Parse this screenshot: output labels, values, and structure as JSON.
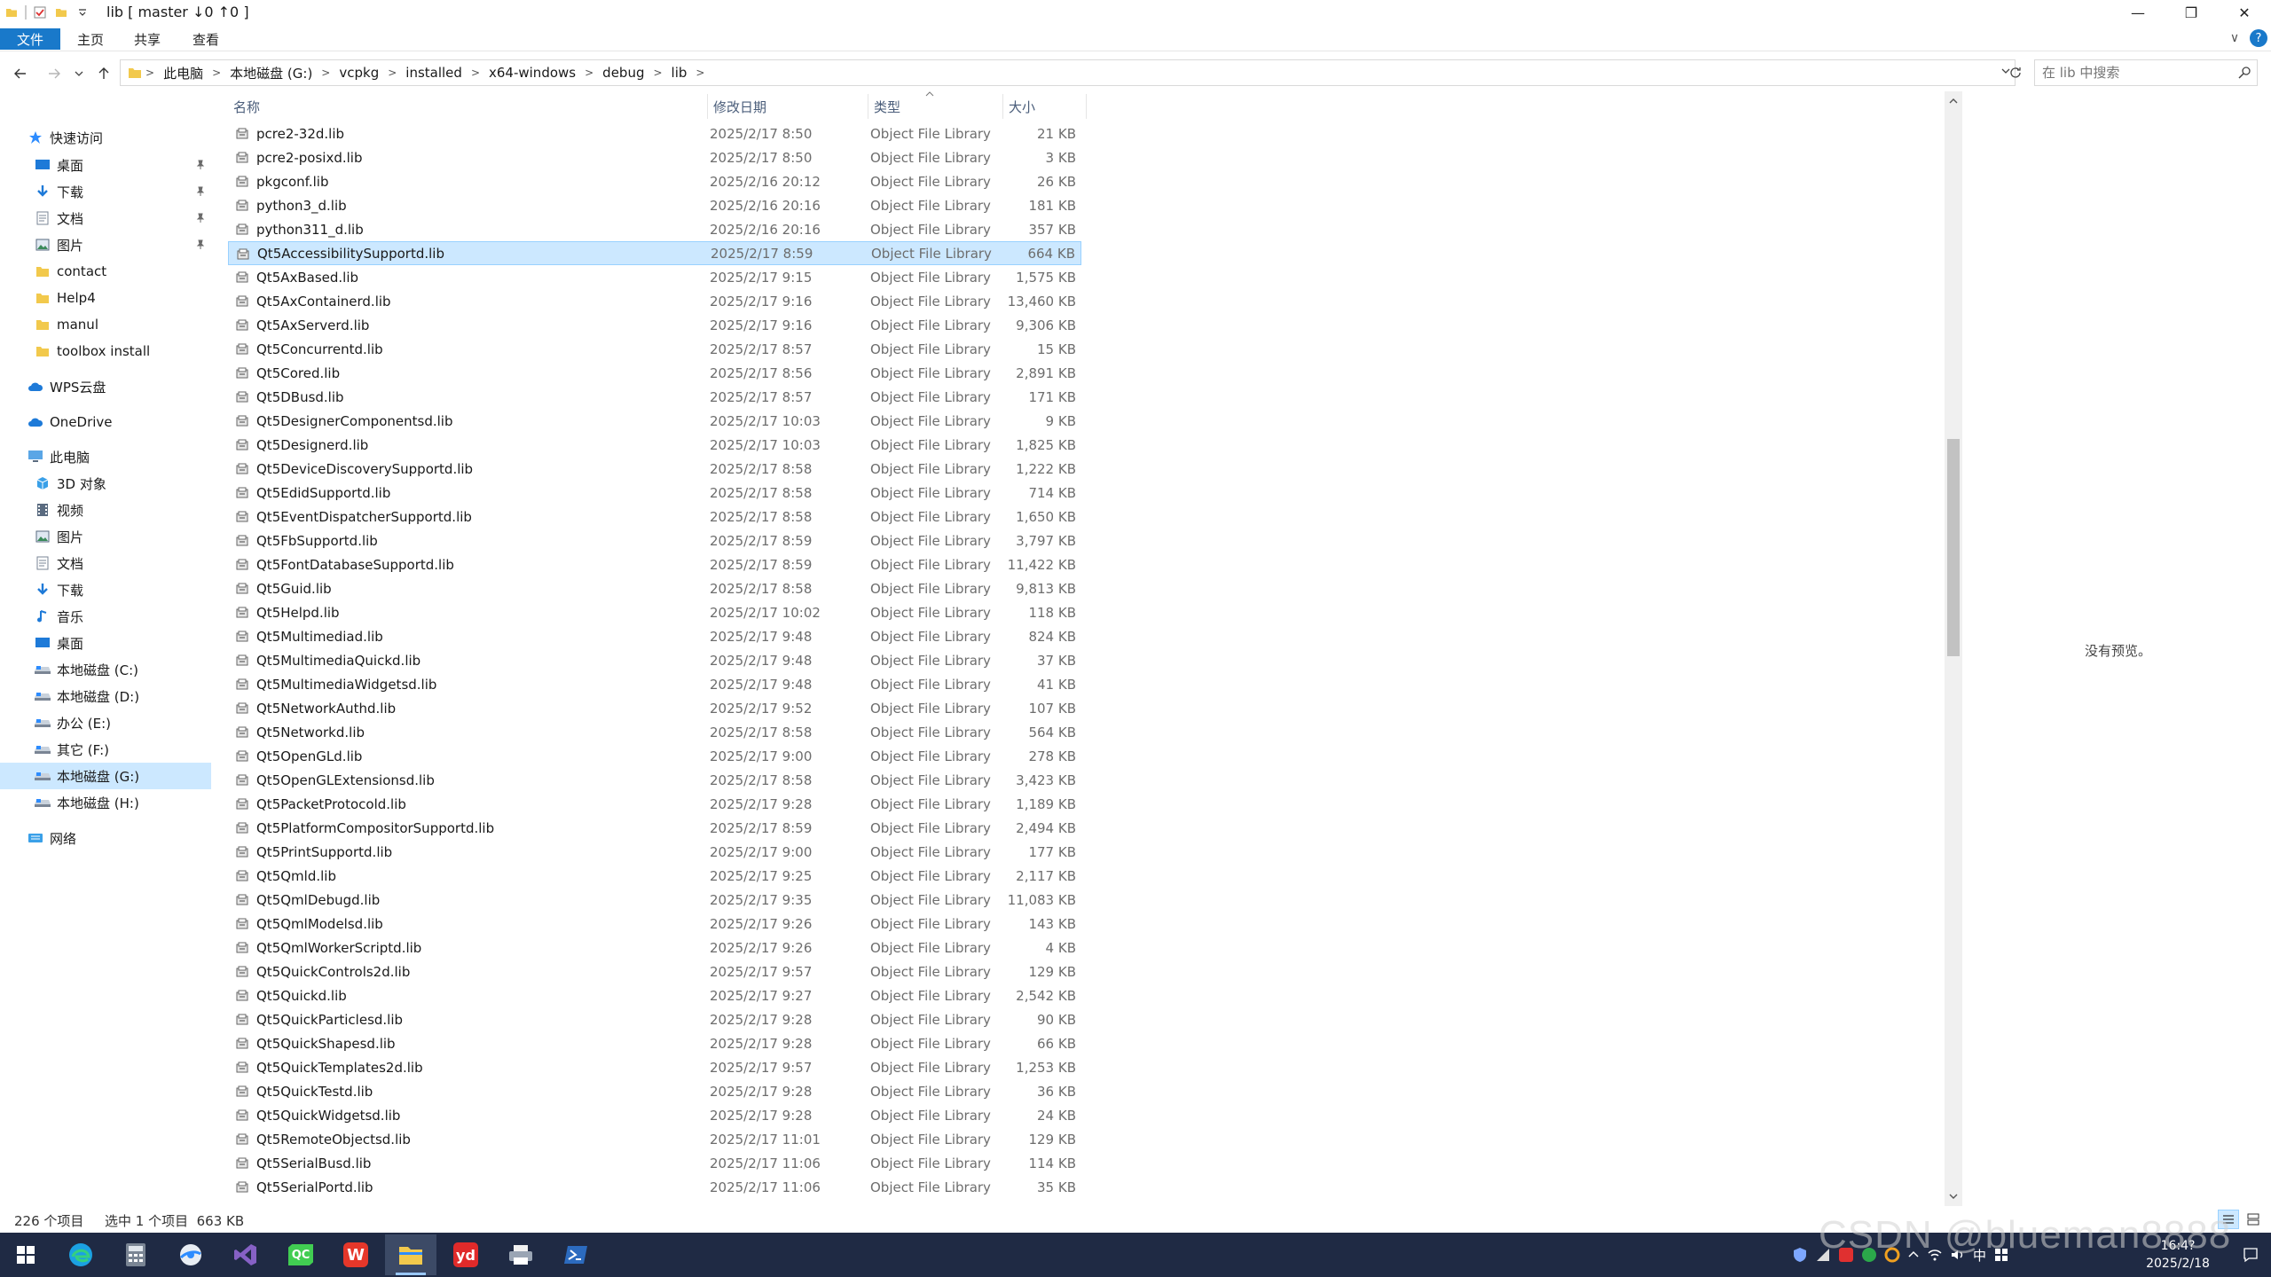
{
  "window": {
    "title": "lib [ master ↓0 ↑0 ]",
    "minimize_glyph": "—",
    "maximize_glyph": "❐",
    "close_glyph": "✕"
  },
  "ribbon": {
    "tabs": [
      "文件",
      "主页",
      "共享",
      "查看"
    ],
    "expand_glyph": "∨",
    "help_glyph": "?"
  },
  "address": {
    "crumbs": [
      "此电脑",
      "本地磁盘 (G:)",
      "vcpkg",
      "installed",
      "x64-windows",
      "debug",
      "lib"
    ],
    "separator": ">"
  },
  "search": {
    "placeholder": "在 lib 中搜索"
  },
  "nav_pane": {
    "items": [
      {
        "label": "快速访问",
        "icon": "star-icon",
        "pinned": false,
        "indent": 1
      },
      {
        "label": "桌面",
        "icon": "desktop-icon",
        "pinned": true,
        "indent": 2
      },
      {
        "label": "下载",
        "icon": "download-icon",
        "pinned": true,
        "indent": 2
      },
      {
        "label": "文档",
        "icon": "document-icon",
        "pinned": true,
        "indent": 2
      },
      {
        "label": "图片",
        "icon": "picture-icon",
        "pinned": true,
        "indent": 2
      },
      {
        "label": "contact",
        "icon": "folder-icon",
        "pinned": false,
        "indent": 2
      },
      {
        "label": "Help4",
        "icon": "folder-icon",
        "pinned": false,
        "indent": 2
      },
      {
        "label": "manul",
        "icon": "folder-icon",
        "pinned": false,
        "indent": 2
      },
      {
        "label": "toolbox install",
        "icon": "folder-icon",
        "pinned": false,
        "indent": 2
      },
      {
        "label": "WPS云盘",
        "icon": "cloud-icon",
        "pinned": false,
        "indent": 1
      },
      {
        "label": "OneDrive",
        "icon": "cloud-icon",
        "pinned": false,
        "indent": 1
      },
      {
        "label": "此电脑",
        "icon": "computer-icon",
        "pinned": false,
        "indent": 1
      },
      {
        "label": "3D 对象",
        "icon": "cube-icon",
        "pinned": false,
        "indent": 2
      },
      {
        "label": "视频",
        "icon": "video-icon",
        "pinned": false,
        "indent": 2
      },
      {
        "label": "图片",
        "icon": "picture-icon",
        "pinned": false,
        "indent": 2
      },
      {
        "label": "文档",
        "icon": "document-icon",
        "pinned": false,
        "indent": 2
      },
      {
        "label": "下载",
        "icon": "download-icon",
        "pinned": false,
        "indent": 2
      },
      {
        "label": "音乐",
        "icon": "music-icon",
        "pinned": false,
        "indent": 2
      },
      {
        "label": "桌面",
        "icon": "desktop-icon",
        "pinned": false,
        "indent": 2
      },
      {
        "label": "本地磁盘 (C:)",
        "icon": "drive-icon",
        "pinned": false,
        "indent": 2
      },
      {
        "label": "本地磁盘 (D:)",
        "icon": "drive-icon",
        "pinned": false,
        "indent": 2
      },
      {
        "label": "办公 (E:)",
        "icon": "drive-icon",
        "pinned": false,
        "indent": 2
      },
      {
        "label": "其它 (F:)",
        "icon": "drive-icon",
        "pinned": false,
        "indent": 2
      },
      {
        "label": "本地磁盘 (G:)",
        "icon": "drive-icon",
        "pinned": false,
        "indent": 2,
        "selected": true
      },
      {
        "label": "本地磁盘 (H:)",
        "icon": "drive-icon",
        "pinned": false,
        "indent": 2
      },
      {
        "label": "网络",
        "icon": "network-icon",
        "pinned": false,
        "indent": 1
      }
    ]
  },
  "columns": {
    "name": "名称",
    "date": "修改日期",
    "type": "类型",
    "size": "大小"
  },
  "files": [
    {
      "name": "pcre2-32d.lib",
      "date": "2025/2/17 8:50",
      "type": "Object File Library",
      "size": "21 KB"
    },
    {
      "name": "pcre2-posixd.lib",
      "date": "2025/2/17 8:50",
      "type": "Object File Library",
      "size": "3 KB"
    },
    {
      "name": "pkgconf.lib",
      "date": "2025/2/16 20:12",
      "type": "Object File Library",
      "size": "26 KB"
    },
    {
      "name": "python3_d.lib",
      "date": "2025/2/16 20:16",
      "type": "Object File Library",
      "size": "181 KB"
    },
    {
      "name": "python311_d.lib",
      "date": "2025/2/16 20:16",
      "type": "Object File Library",
      "size": "357 KB"
    },
    {
      "name": "Qt5AccessibilitySupportd.lib",
      "date": "2025/2/17 8:59",
      "type": "Object File Library",
      "size": "664 KB",
      "selected": true
    },
    {
      "name": "Qt5AxBased.lib",
      "date": "2025/2/17 9:15",
      "type": "Object File Library",
      "size": "1,575 KB"
    },
    {
      "name": "Qt5AxContainerd.lib",
      "date": "2025/2/17 9:16",
      "type": "Object File Library",
      "size": "13,460 KB"
    },
    {
      "name": "Qt5AxServerd.lib",
      "date": "2025/2/17 9:16",
      "type": "Object File Library",
      "size": "9,306 KB"
    },
    {
      "name": "Qt5Concurrentd.lib",
      "date": "2025/2/17 8:57",
      "type": "Object File Library",
      "size": "15 KB"
    },
    {
      "name": "Qt5Cored.lib",
      "date": "2025/2/17 8:56",
      "type": "Object File Library",
      "size": "2,891 KB"
    },
    {
      "name": "Qt5DBusd.lib",
      "date": "2025/2/17 8:57",
      "type": "Object File Library",
      "size": "171 KB"
    },
    {
      "name": "Qt5DesignerComponentsd.lib",
      "date": "2025/2/17 10:03",
      "type": "Object File Library",
      "size": "9 KB"
    },
    {
      "name": "Qt5Designerd.lib",
      "date": "2025/2/17 10:03",
      "type": "Object File Library",
      "size": "1,825 KB"
    },
    {
      "name": "Qt5DeviceDiscoverySupportd.lib",
      "date": "2025/2/17 8:58",
      "type": "Object File Library",
      "size": "1,222 KB"
    },
    {
      "name": "Qt5EdidSupportd.lib",
      "date": "2025/2/17 8:58",
      "type": "Object File Library",
      "size": "714 KB"
    },
    {
      "name": "Qt5EventDispatcherSupportd.lib",
      "date": "2025/2/17 8:58",
      "type": "Object File Library",
      "size": "1,650 KB"
    },
    {
      "name": "Qt5FbSupportd.lib",
      "date": "2025/2/17 8:59",
      "type": "Object File Library",
      "size": "3,797 KB"
    },
    {
      "name": "Qt5FontDatabaseSupportd.lib",
      "date": "2025/2/17 8:59",
      "type": "Object File Library",
      "size": "11,422 KB"
    },
    {
      "name": "Qt5Guid.lib",
      "date": "2025/2/17 8:58",
      "type": "Object File Library",
      "size": "9,813 KB"
    },
    {
      "name": "Qt5Helpd.lib",
      "date": "2025/2/17 10:02",
      "type": "Object File Library",
      "size": "118 KB"
    },
    {
      "name": "Qt5Multimediad.lib",
      "date": "2025/2/17 9:48",
      "type": "Object File Library",
      "size": "824 KB"
    },
    {
      "name": "Qt5MultimediaQuickd.lib",
      "date": "2025/2/17 9:48",
      "type": "Object File Library",
      "size": "37 KB"
    },
    {
      "name": "Qt5MultimediaWidgetsd.lib",
      "date": "2025/2/17 9:48",
      "type": "Object File Library",
      "size": "41 KB"
    },
    {
      "name": "Qt5NetworkAuthd.lib",
      "date": "2025/2/17 9:52",
      "type": "Object File Library",
      "size": "107 KB"
    },
    {
      "name": "Qt5Networkd.lib",
      "date": "2025/2/17 8:58",
      "type": "Object File Library",
      "size": "564 KB"
    },
    {
      "name": "Qt5OpenGLd.lib",
      "date": "2025/2/17 9:00",
      "type": "Object File Library",
      "size": "278 KB"
    },
    {
      "name": "Qt5OpenGLExtensionsd.lib",
      "date": "2025/2/17 8:58",
      "type": "Object File Library",
      "size": "3,423 KB"
    },
    {
      "name": "Qt5PacketProtocold.lib",
      "date": "2025/2/17 9:28",
      "type": "Object File Library",
      "size": "1,189 KB"
    },
    {
      "name": "Qt5PlatformCompositorSupportd.lib",
      "date": "2025/2/17 8:59",
      "type": "Object File Library",
      "size": "2,494 KB"
    },
    {
      "name": "Qt5PrintSupportd.lib",
      "date": "2025/2/17 9:00",
      "type": "Object File Library",
      "size": "177 KB"
    },
    {
      "name": "Qt5Qmld.lib",
      "date": "2025/2/17 9:25",
      "type": "Object File Library",
      "size": "2,117 KB"
    },
    {
      "name": "Qt5QmlDebugd.lib",
      "date": "2025/2/17 9:35",
      "type": "Object File Library",
      "size": "11,083 KB"
    },
    {
      "name": "Qt5QmlModelsd.lib",
      "date": "2025/2/17 9:26",
      "type": "Object File Library",
      "size": "143 KB"
    },
    {
      "name": "Qt5QmlWorkerScriptd.lib",
      "date": "2025/2/17 9:26",
      "type": "Object File Library",
      "size": "4 KB"
    },
    {
      "name": "Qt5QuickControls2d.lib",
      "date": "2025/2/17 9:57",
      "type": "Object File Library",
      "size": "129 KB"
    },
    {
      "name": "Qt5Quickd.lib",
      "date": "2025/2/17 9:27",
      "type": "Object File Library",
      "size": "2,542 KB"
    },
    {
      "name": "Qt5QuickParticlesd.lib",
      "date": "2025/2/17 9:28",
      "type": "Object File Library",
      "size": "90 KB"
    },
    {
      "name": "Qt5QuickShapesd.lib",
      "date": "2025/2/17 9:28",
      "type": "Object File Library",
      "size": "66 KB"
    },
    {
      "name": "Qt5QuickTemplates2d.lib",
      "date": "2025/2/17 9:57",
      "type": "Object File Library",
      "size": "1,253 KB"
    },
    {
      "name": "Qt5QuickTestd.lib",
      "date": "2025/2/17 9:28",
      "type": "Object File Library",
      "size": "36 KB"
    },
    {
      "name": "Qt5QuickWidgetsd.lib",
      "date": "2025/2/17 9:28",
      "type": "Object File Library",
      "size": "24 KB"
    },
    {
      "name": "Qt5RemoteObjectsd.lib",
      "date": "2025/2/17 11:01",
      "type": "Object File Library",
      "size": "129 KB"
    },
    {
      "name": "Qt5SerialBusd.lib",
      "date": "2025/2/17 11:06",
      "type": "Object File Library",
      "size": "114 KB"
    },
    {
      "name": "Qt5SerialPortd.lib",
      "date": "2025/2/17 11:06",
      "type": "Object File Library",
      "size": "35 KB"
    }
  ],
  "preview": {
    "empty_text": "没有预览。"
  },
  "status": {
    "item_count": "226 个项目",
    "selection": "选中 1 个项目  663 KB"
  },
  "taskbar": {
    "apps": [
      "windows-start-icon",
      "edge-icon",
      "calculator-icon",
      "browser-icon",
      "visual-studio-icon",
      "qt-creator-icon",
      "wps-icon",
      "file-explorer-icon",
      "youdao-icon",
      "printer-icon",
      "powershell-icon"
    ],
    "active_app": "file-explorer-icon",
    "qt_label": "QC",
    "youdao_label": "yd",
    "wps_label": "W",
    "tray_input": "中",
    "clock_time": "16:4?",
    "clock_date": "2025/2/18"
  },
  "watermark": "CSDN @blueman8888",
  "colors": {
    "accent": "#1979ca",
    "selection_bg": "#cce8ff",
    "selection_border": "#99d1ff",
    "taskbar": "#1f2a44"
  }
}
